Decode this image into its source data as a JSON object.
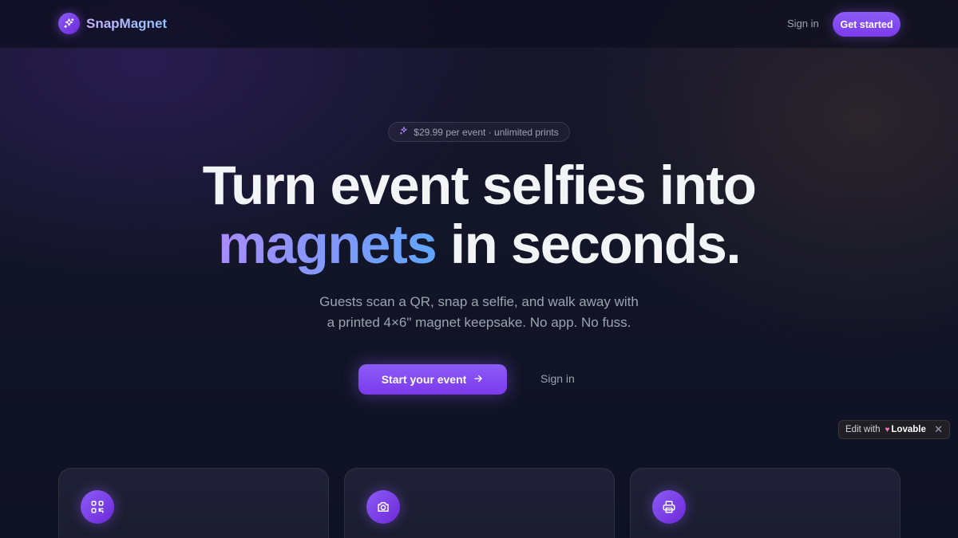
{
  "header": {
    "brand_name": "SnapMagnet",
    "brand_icon": "sparkles-icon",
    "sign_in_label": "Sign in",
    "get_started_label": "Get started"
  },
  "hero": {
    "pill_icon": "sparkles-icon",
    "pill_text": "$29.99 per event · unlimited prints",
    "headline_line1": "Turn event selfies into",
    "headline_highlight": "magnets",
    "headline_line2_rest": " in seconds.",
    "subtitle_line1": "Guests scan a QR, snap a selfie, and walk away with",
    "subtitle_line2": "a printed 4×6\" magnet keepsake. No app. No fuss.",
    "primary_cta_label": "Start your event",
    "primary_cta_icon": "arrow-right-icon",
    "secondary_cta_label": "Sign in"
  },
  "badge": {
    "edit_with": "Edit with",
    "brand": "Lovable",
    "close": "✕"
  },
  "features": [
    {
      "icon": "qr-code-icon"
    },
    {
      "icon": "camera-icon"
    },
    {
      "icon": "printer-icon"
    }
  ],
  "colors": {
    "accent": "#7c3aed",
    "accent_light": "#8b5cf6",
    "highlight_start": "#a78bfa",
    "highlight_end": "#60a5fa",
    "background": "#131528"
  }
}
